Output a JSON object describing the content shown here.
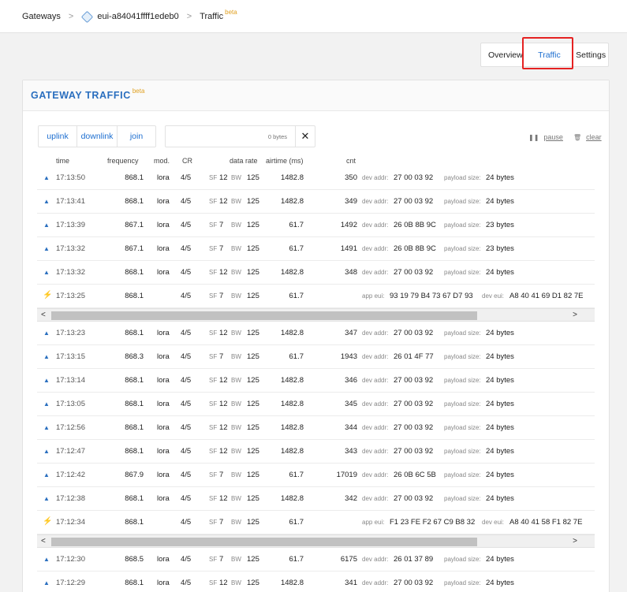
{
  "breadcrumb": {
    "gateways": "Gateways",
    "sep": ">",
    "gateway_id": "eui-a84041ffff1edeb0",
    "traffic": "Traffic",
    "beta": "beta"
  },
  "tabs": {
    "overview": "Overview",
    "traffic": "Traffic",
    "settings": "Settings"
  },
  "panel": {
    "title": "GATEWAY TRAFFIC",
    "beta": "beta"
  },
  "filters": {
    "uplink": "uplink",
    "downlink": "downlink",
    "join": "join",
    "search_placeholder": "0 bytes"
  },
  "actions": {
    "pause": "pause",
    "clear": "clear"
  },
  "columns": {
    "time": "time",
    "frequency": "frequency",
    "mod": "mod.",
    "cr": "CR",
    "data_rate": "data rate",
    "airtime": "airtime (ms)",
    "cnt": "cnt"
  },
  "labels": {
    "dev_addr": "dev addr:",
    "payload_size": "payload size:",
    "app_eui": "app eui:",
    "dev_eui": "dev eui:",
    "sf": "SF",
    "bw": "BW"
  },
  "rows_a": [
    {
      "time": "17:13:50",
      "freq": "868.1",
      "mod": "lora",
      "cr": "4/5",
      "sf": "12",
      "bw": "125",
      "air": "1482.8",
      "cnt": "350",
      "addr": "27 00 03 92",
      "size": "24 bytes"
    },
    {
      "time": "17:13:41",
      "freq": "868.1",
      "mod": "lora",
      "cr": "4/5",
      "sf": "12",
      "bw": "125",
      "air": "1482.8",
      "cnt": "349",
      "addr": "27 00 03 92",
      "size": "24 bytes"
    },
    {
      "time": "17:13:39",
      "freq": "867.1",
      "mod": "lora",
      "cr": "4/5",
      "sf": "7",
      "bw": "125",
      "air": "61.7",
      "cnt": "1492",
      "addr": "26 0B 8B 9C",
      "size": "23 bytes"
    },
    {
      "time": "17:13:32",
      "freq": "867.1",
      "mod": "lora",
      "cr": "4/5",
      "sf": "7",
      "bw": "125",
      "air": "61.7",
      "cnt": "1491",
      "addr": "26 0B 8B 9C",
      "size": "23 bytes"
    },
    {
      "time": "17:13:32",
      "freq": "868.1",
      "mod": "lora",
      "cr": "4/5",
      "sf": "12",
      "bw": "125",
      "air": "1482.8",
      "cnt": "348",
      "addr": "27 00 03 92",
      "size": "24 bytes"
    }
  ],
  "join_a": {
    "time": "17:13:25",
    "freq": "868.1",
    "cr": "4/5",
    "sf": "7",
    "bw": "125",
    "air": "61.7",
    "app_eui": "93 19 79 B4 73 67 D7 93",
    "dev_eui": "A8 40 41 69 D1 82 7E"
  },
  "rows_b": [
    {
      "time": "17:13:23",
      "freq": "868.1",
      "mod": "lora",
      "cr": "4/5",
      "sf": "12",
      "bw": "125",
      "air": "1482.8",
      "cnt": "347",
      "addr": "27 00 03 92",
      "size": "24 bytes"
    },
    {
      "time": "17:13:15",
      "freq": "868.3",
      "mod": "lora",
      "cr": "4/5",
      "sf": "7",
      "bw": "125",
      "air": "61.7",
      "cnt": "1943",
      "addr": "26 01 4F 77",
      "size": "24 bytes"
    },
    {
      "time": "17:13:14",
      "freq": "868.1",
      "mod": "lora",
      "cr": "4/5",
      "sf": "12",
      "bw": "125",
      "air": "1482.8",
      "cnt": "346",
      "addr": "27 00 03 92",
      "size": "24 bytes"
    },
    {
      "time": "17:13:05",
      "freq": "868.1",
      "mod": "lora",
      "cr": "4/5",
      "sf": "12",
      "bw": "125",
      "air": "1482.8",
      "cnt": "345",
      "addr": "27 00 03 92",
      "size": "24 bytes"
    },
    {
      "time": "17:12:56",
      "freq": "868.1",
      "mod": "lora",
      "cr": "4/5",
      "sf": "12",
      "bw": "125",
      "air": "1482.8",
      "cnt": "344",
      "addr": "27 00 03 92",
      "size": "24 bytes"
    },
    {
      "time": "17:12:47",
      "freq": "868.1",
      "mod": "lora",
      "cr": "4/5",
      "sf": "12",
      "bw": "125",
      "air": "1482.8",
      "cnt": "343",
      "addr": "27 00 03 92",
      "size": "24 bytes"
    },
    {
      "time": "17:12:42",
      "freq": "867.9",
      "mod": "lora",
      "cr": "4/5",
      "sf": "7",
      "bw": "125",
      "air": "61.7",
      "cnt": "17019",
      "addr": "26 0B 6C 5B",
      "size": "24 bytes"
    },
    {
      "time": "17:12:38",
      "freq": "868.1",
      "mod": "lora",
      "cr": "4/5",
      "sf": "12",
      "bw": "125",
      "air": "1482.8",
      "cnt": "342",
      "addr": "27 00 03 92",
      "size": "24 bytes"
    }
  ],
  "join_b": {
    "time": "17:12:34",
    "freq": "868.1",
    "cr": "4/5",
    "sf": "7",
    "bw": "125",
    "air": "61.7",
    "app_eui": "F1 23 FE F2 67 C9 B8 32",
    "dev_eui": "A8 40 41 58 F1 82 7E"
  },
  "rows_c": [
    {
      "time": "17:12:30",
      "freq": "868.5",
      "mod": "lora",
      "cr": "4/5",
      "sf": "7",
      "bw": "125",
      "air": "61.7",
      "cnt": "6175",
      "addr": "26 01 37 89",
      "size": "24 bytes"
    },
    {
      "time": "17:12:29",
      "freq": "868.1",
      "mod": "lora",
      "cr": "4/5",
      "sf": "12",
      "bw": "125",
      "air": "1482.8",
      "cnt": "341",
      "addr": "27 00 03 92",
      "size": "24 bytes"
    }
  ],
  "icons": {
    "uplink": "uplink-arrow-icon",
    "join": "join-bolt-icon",
    "pause": "pause-icon",
    "clear": "trash-icon",
    "close": "close-icon"
  },
  "colors": {
    "accent": "#1e6fd0",
    "highlight": "#e52222",
    "beta": "#e0a020",
    "join": "#f0a020"
  }
}
